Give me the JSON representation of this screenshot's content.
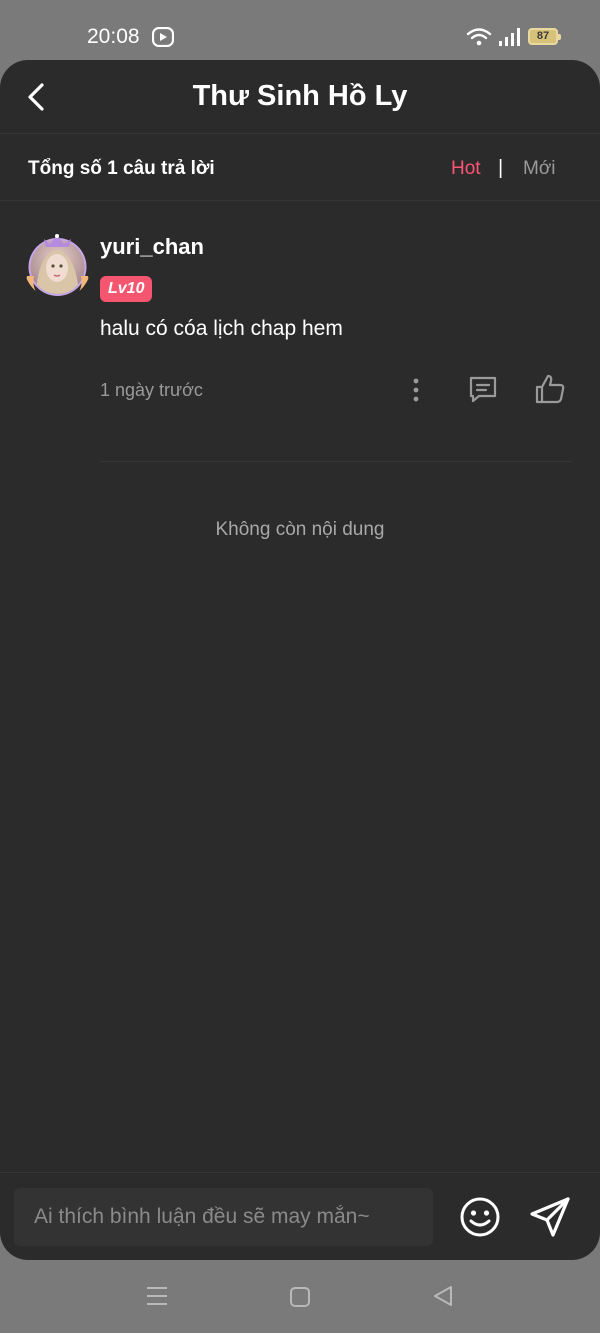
{
  "status_bar": {
    "time": "20:08",
    "battery": "87",
    "icons": [
      "app-notification-icon",
      "wifi-icon",
      "signal-icon",
      "battery-icon"
    ]
  },
  "header": {
    "title": "Thư Sinh Hồ Ly",
    "back_icon": "chevron-left-icon"
  },
  "summary": {
    "total_text": "Tổng số 1 câu trả lời",
    "sort_hot": "Hot",
    "sort_separator": "|",
    "sort_new": "Mới",
    "active_sort": "Hot"
  },
  "comments": [
    {
      "username": "yuri_chan",
      "level": "Lv10",
      "text": "halu có cóa lịch chap hem",
      "time": "1 ngày trước"
    }
  ],
  "footer_note": "Không còn nội dung",
  "input": {
    "placeholder": "Ai thích bình luận đều sẽ may mắn~",
    "value": ""
  },
  "colors": {
    "accent": "#ff5474",
    "level_badge": "#f4566f",
    "background": "#2b2b2b",
    "muted_text": "#9a9a9a"
  }
}
